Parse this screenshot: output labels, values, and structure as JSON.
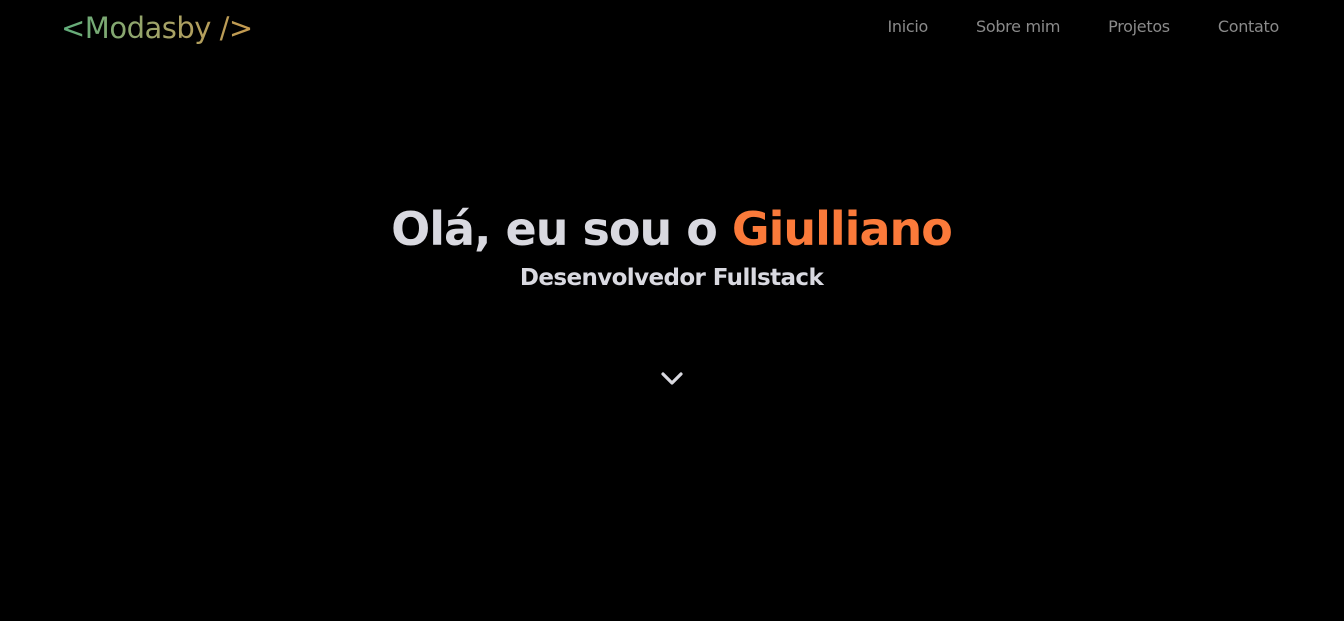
{
  "header": {
    "logo": "<Modasby />",
    "nav": [
      "Inicio",
      "Sobre mim",
      "Projetos",
      "Contato"
    ]
  },
  "hero": {
    "greeting": "Olá, eu sou o",
    "name": "Giulliano",
    "subtitle": "Desenvolvedor Fullstack"
  },
  "icons": {
    "scroll": "chevron-down-icon"
  },
  "colors": {
    "background": "#000000",
    "text": "#d9d9e0",
    "accent": "#fb7a3a",
    "nav": "#8a8a8a",
    "logo_gradient_start": "#5fae7c",
    "logo_gradient_end": "#c69a4e"
  }
}
